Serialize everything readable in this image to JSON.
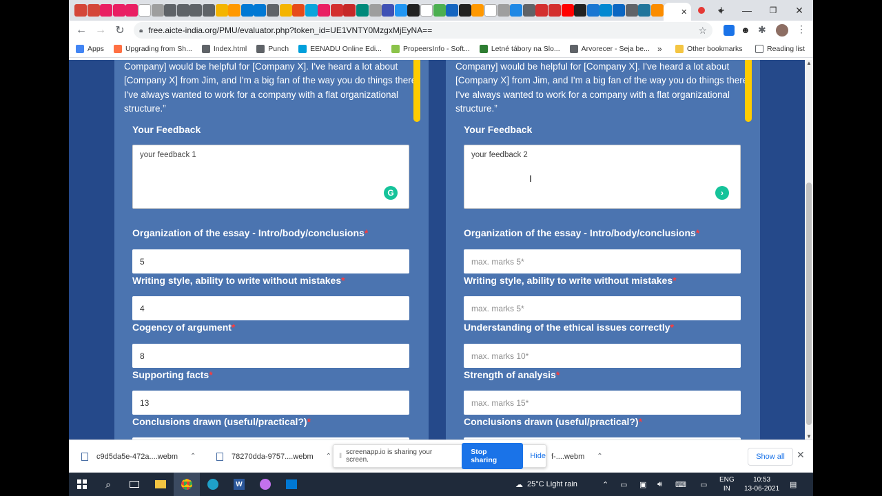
{
  "browser": {
    "url": "free.aicte-india.org/PMU/evaluator.php?token_id=UE1VNTY0MzgxMjEyNA==",
    "tab_close_glyph": "✕",
    "new_tab_glyph": "+",
    "window": {
      "minimize": "—",
      "restore": "❐",
      "close": "✕"
    }
  },
  "bookmarks": [
    {
      "label": "Apps",
      "color": "#4285f4"
    },
    {
      "label": "Upgrading from Sh...",
      "color": "#ff7043"
    },
    {
      "label": "Index.html",
      "color": "#5f6368"
    },
    {
      "label": "Punch",
      "color": "#5f6368"
    },
    {
      "label": "EENADU Online Edi...",
      "color": "#00a0dc"
    },
    {
      "label": "PropeersInfo - Soft...",
      "color": "#8bc34a"
    },
    {
      "label": "Letné tábory na Slo...",
      "color": "#2e7d32"
    },
    {
      "label": "Arvorecer - Seja be...",
      "color": "#5f6368"
    }
  ],
  "bookmarks_right": {
    "more": "»",
    "other": "Other bookmarks",
    "reading": "Reading list"
  },
  "form": {
    "quote_text": "Company] would be helpful for [Company X]. I've heard a lot about [Company X] from Jim, and I'm a big fan of the way you do things there. I've always wanted to work for a company with a flat organizational structure.”",
    "feedback_label": "Your Feedback",
    "required_mark": "*",
    "left": {
      "feedback_value": "your feedback 1",
      "fields": [
        {
          "label": "Organization of the essay - Intro/body/conclusions",
          "value": "5"
        },
        {
          "label": "Writing style, ability to write without mistakes",
          "value": "4"
        },
        {
          "label": "Cogency of argument",
          "value": "8"
        },
        {
          "label": "Supporting facts",
          "value": "13"
        },
        {
          "label": "Conclusions drawn (useful/practical?)",
          "value": ""
        }
      ]
    },
    "right": {
      "feedback_value": "your feedback 2",
      "fields": [
        {
          "label": "Organization of the essay - Intro/body/conclusions",
          "placeholder": "max. marks 5*"
        },
        {
          "label": "Writing style, ability to write without mistakes",
          "placeholder": "max. marks 5*"
        },
        {
          "label": "Understanding of the ethical issues correctly",
          "placeholder": "max. marks 10*"
        },
        {
          "label": "Strength of analysis",
          "placeholder": "max. marks 15*"
        },
        {
          "label": "Conclusions drawn (useful/practical?)",
          "placeholder": ""
        }
      ]
    }
  },
  "downloads": {
    "items": [
      {
        "name": "c9d5da5e-472a....webm"
      },
      {
        "name": "78270dda-9757....webm"
      },
      {
        "name": "f-....webm"
      }
    ],
    "sharing_msg": "screenapp.io is sharing your screen.",
    "stop_label": "Stop sharing",
    "hide_label": "Hide",
    "show_all": "Show all"
  },
  "taskbar": {
    "weather": "25°C  Light rain",
    "lang_top": "ENG",
    "lang_bottom": "IN",
    "time": "10:53",
    "date": "13-06-2021"
  }
}
